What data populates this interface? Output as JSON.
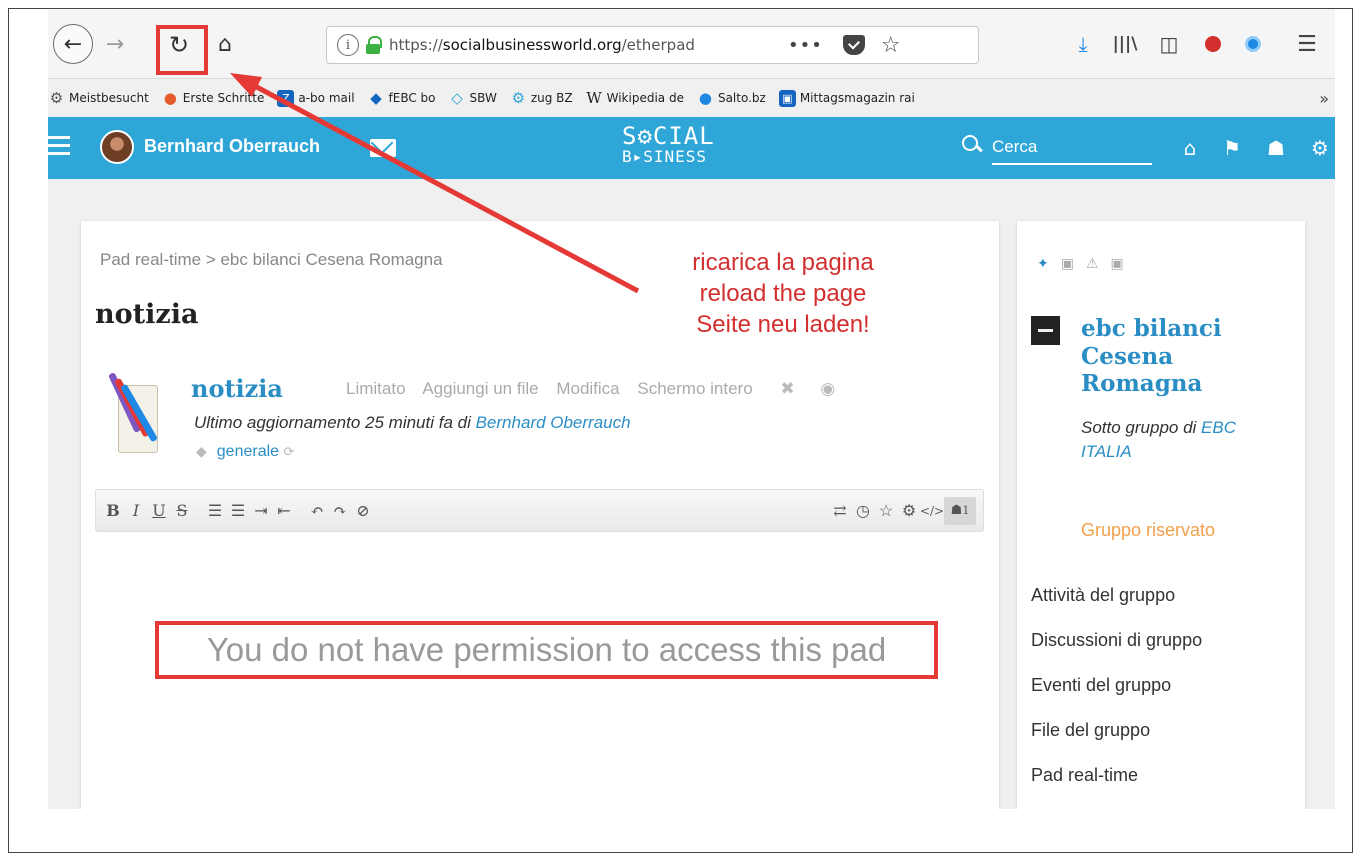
{
  "browser": {
    "url_prefix": "https://",
    "url_domain": "socialbusinessworld.org",
    "url_path": "/etherpad",
    "more_label": "•••",
    "bookmarks": [
      {
        "label": "Meistbesucht",
        "icon": "gear-icon",
        "color": "#555555"
      },
      {
        "label": "Erste Schritte",
        "icon": "firefox-icon",
        "color": "#e55b2b"
      },
      {
        "label": "a-bo mail",
        "icon": "z-icon",
        "color": "#1565c0"
      },
      {
        "label": "fEBC bo",
        "icon": "diamond-icon",
        "color": "#1565c0"
      },
      {
        "label": "SBW",
        "icon": "sbw-icon",
        "color": "#2fa6d8"
      },
      {
        "label": "zug BZ",
        "icon": "gear-icon",
        "color": "#2fa6d8"
      },
      {
        "label": "Wikipedia de",
        "icon": "wikipedia-icon",
        "color": "#ffffff"
      },
      {
        "label": "Salto.bz",
        "icon": "circle-icon",
        "color": "#1e88e5"
      },
      {
        "label": "Mittagsmagazin rai",
        "icon": "rai-icon",
        "color": "#1565c0"
      }
    ],
    "bookmarks_more": "»"
  },
  "site": {
    "user_name": "Bernhard Oberrauch",
    "logo_top": "S⚙CIAL",
    "logo_bottom": "B▸SINESS",
    "search_placeholder": "Cerca"
  },
  "main": {
    "breadcrumb": "Pad real-time > ebc bilanci Cesena Romagna",
    "page_title": "notizia",
    "pad_title": "notizia",
    "actions": [
      "Limitato",
      "Aggiungi un file",
      "Modifica",
      "Schermo intero"
    ],
    "meta_prefix": "Ultimo aggiornamento 25 minuti fa di ",
    "meta_author": "Bernhard Oberrauch",
    "tag": "generale",
    "users_count": "1",
    "no_permission": "You do not have permission to access this pad"
  },
  "side": {
    "group_name": "ebc bilanci Cesena Romagna",
    "subgroup_prefix": "Sotto gruppo di ",
    "subgroup_link": "EBC ITALIA",
    "group_status": "Gruppo riservato",
    "links": [
      "Attività del gruppo",
      "Discussioni di gruppo",
      "Eventi del gruppo",
      "File del gruppo",
      "Pad real-time"
    ]
  },
  "annotation": {
    "line1": "ricarica la pagina",
    "line2": "reload the page",
    "line3": "Seite neu laden!",
    "color": "#e53935"
  }
}
